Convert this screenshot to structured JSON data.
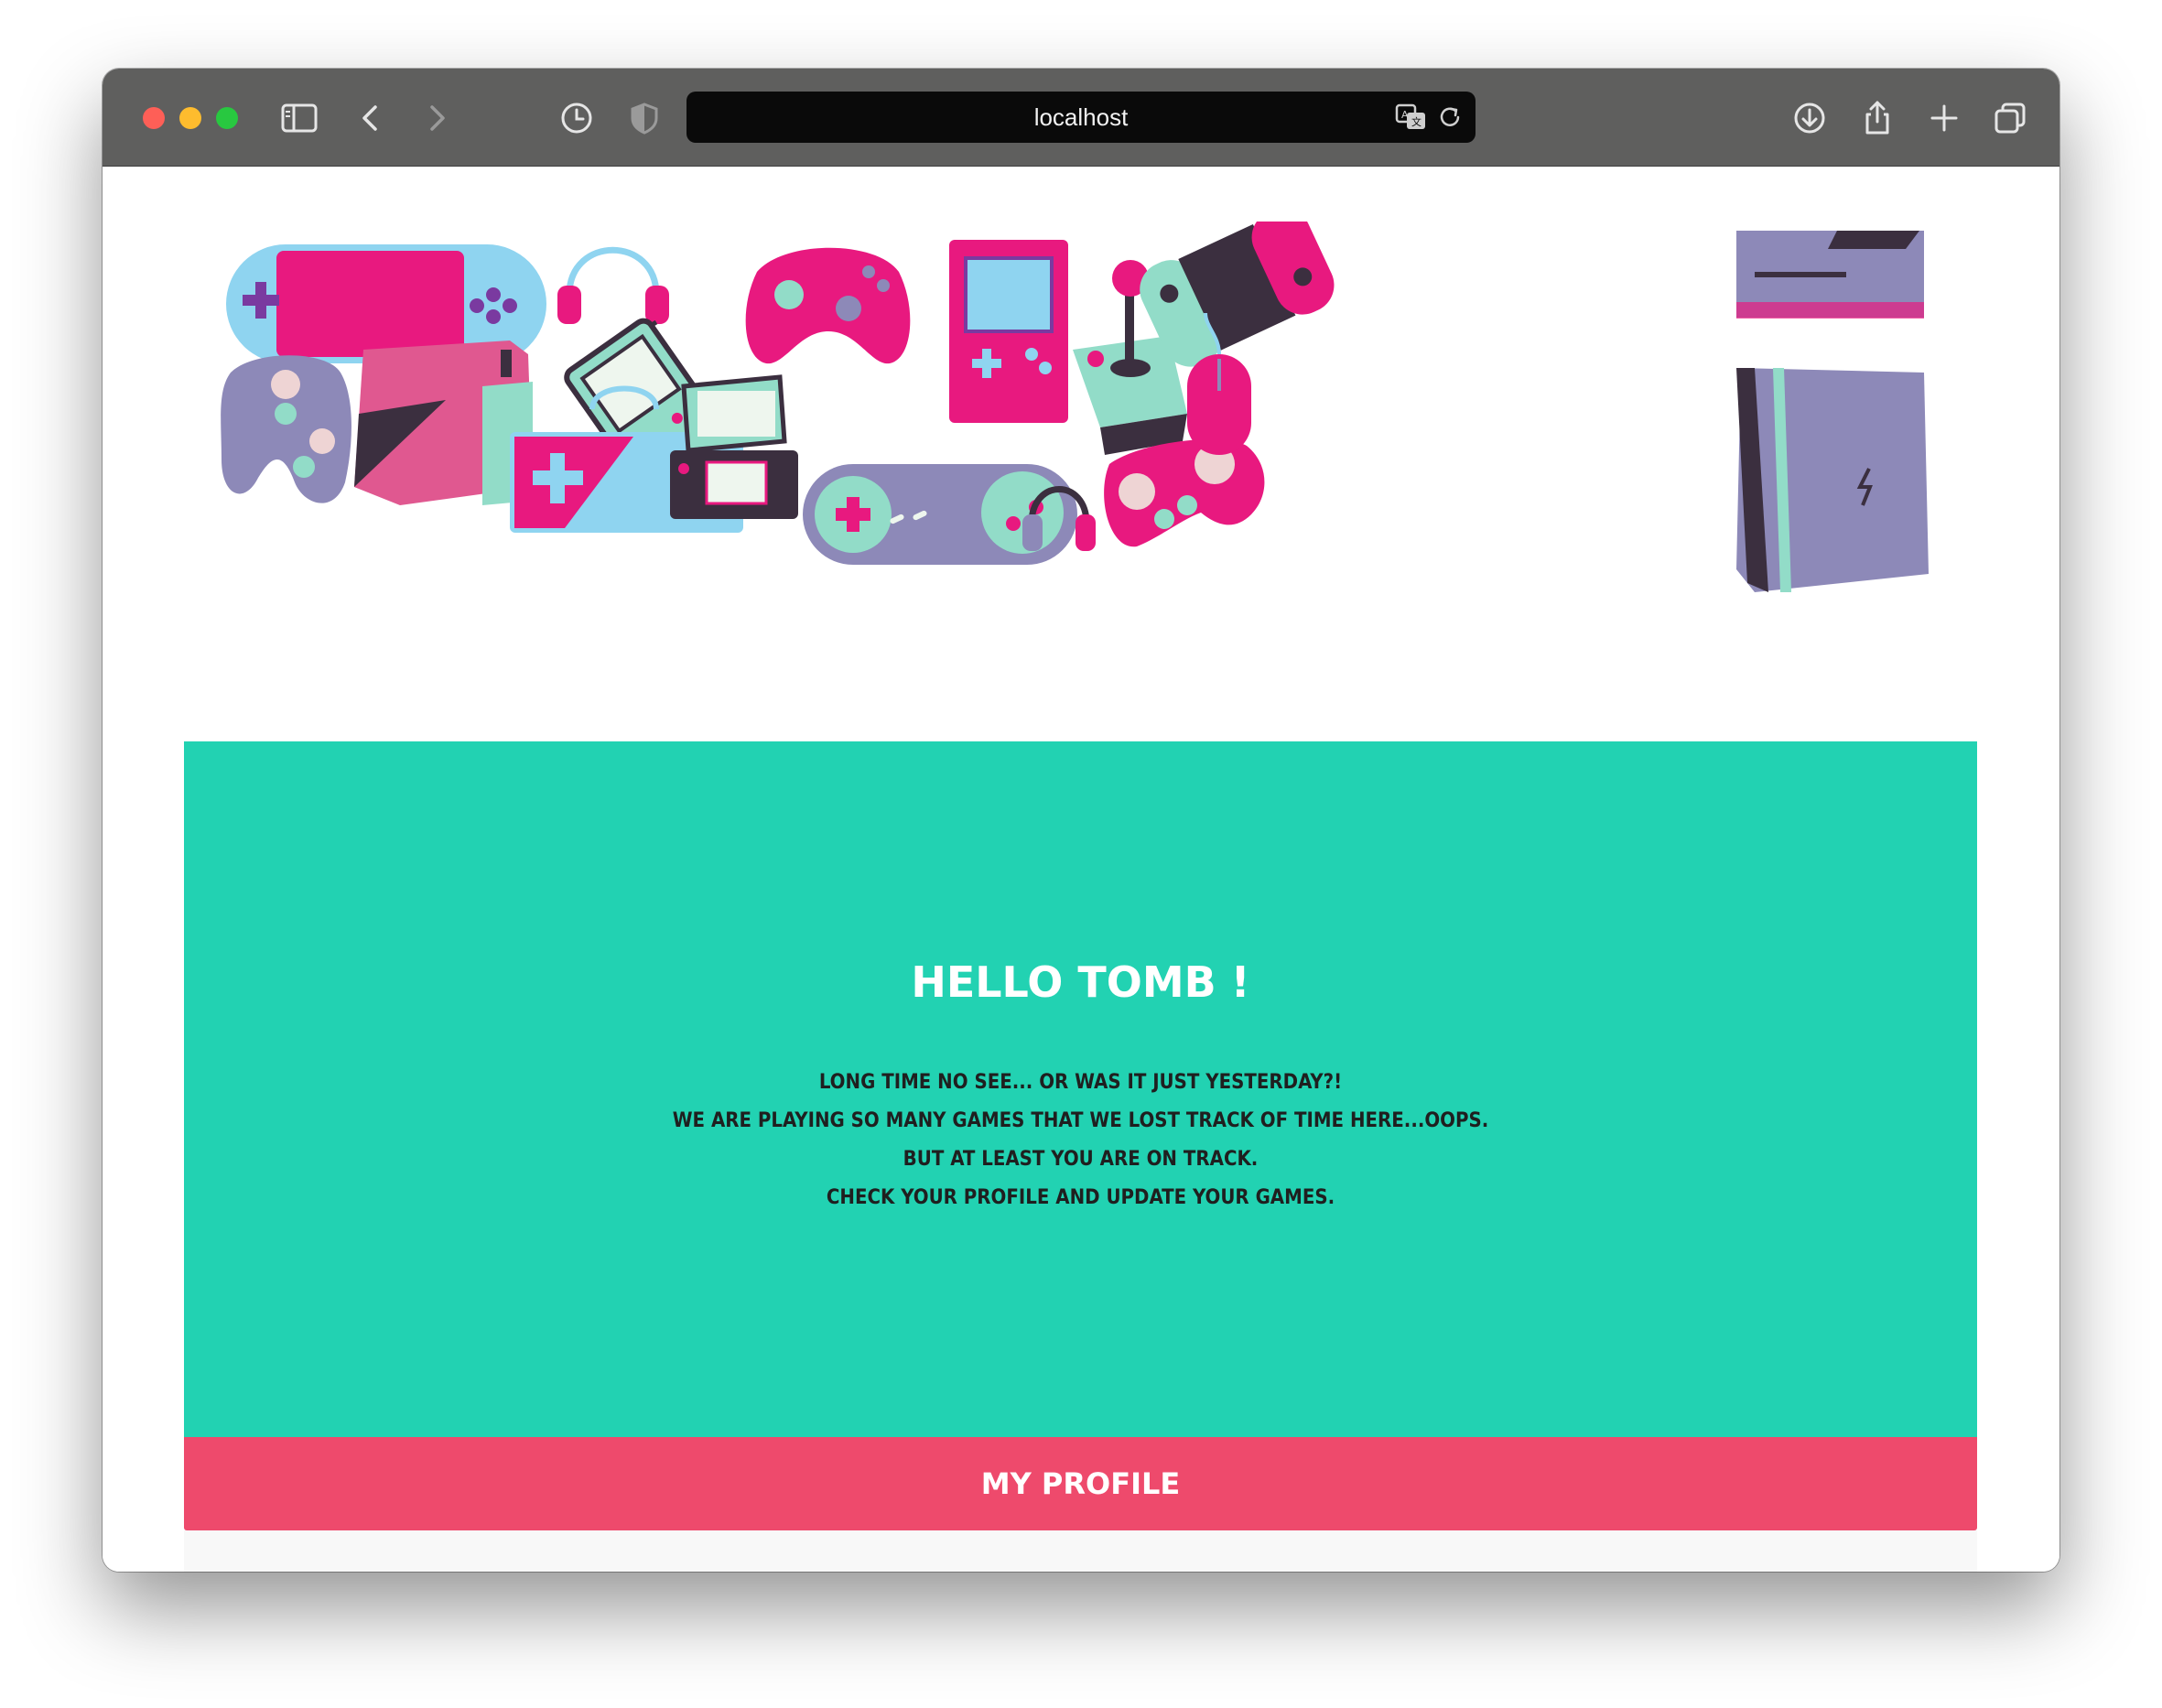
{
  "browser": {
    "url": "localhost",
    "icons": [
      "sidebar-icon",
      "back-icon",
      "forward-icon",
      "history-icon",
      "privacy-shield-icon",
      "translate-icon",
      "reload-icon",
      "download-icon",
      "share-icon",
      "new-tab-icon",
      "tabs-overview-icon"
    ],
    "traffic_colors": {
      "close": "#fe5f57",
      "minimize": "#febc2e",
      "maximize": "#28c840"
    }
  },
  "banner": {
    "icons": [
      "handheld-console-icon",
      "headset-icon",
      "retro-handheld-icon",
      "xbox-controller-icon",
      "gameboy-icon",
      "joystick-icon",
      "switch-console-icon",
      "xbox-one-icon",
      "ps4-controller-icon",
      "console-box-icon",
      "nes-controller-icon",
      "ds-handheld-icon",
      "snes-controller-icon",
      "small-headphones-icon",
      "pink-controller-icon",
      "mouse-icon",
      "ps4-pro-icon"
    ],
    "colors": {
      "pink": "#e8197f",
      "mint": "#92dcc8",
      "lavender": "#8d89b8",
      "dark": "#3b2f3f",
      "sky": "#8fd4f0"
    }
  },
  "hero": {
    "title": "HELLO TOMB !",
    "lines": [
      "LONG TIME NO SEE... OR WAS IT JUST YESTERDAY?!",
      "WE ARE PLAYING SO MANY GAMES THAT WE LOST TRACK OF TIME HERE...OOPS.",
      "BUT AT LEAST YOU ARE ON TRACK.",
      "CHECK YOUR PROFILE AND UPDATE YOUR GAMES."
    ],
    "background": "#22d2b2"
  },
  "profile_button": {
    "label": "MY PROFILE",
    "background": "#ee4a6c"
  }
}
